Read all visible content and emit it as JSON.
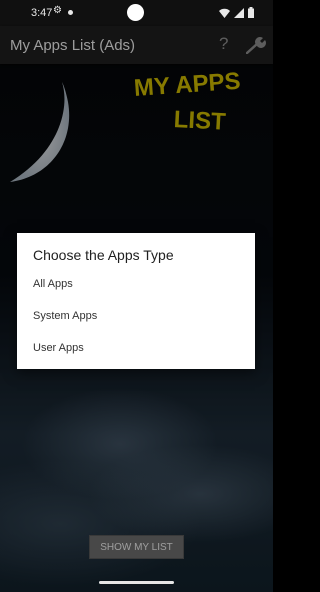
{
  "status_bar": {
    "time": "3:47"
  },
  "app_bar": {
    "title": "My Apps List (Ads)",
    "help_label": "?"
  },
  "logo": {
    "line1": "MY APPS",
    "line2": "LIST"
  },
  "dialog": {
    "title": "Choose the Apps Type",
    "options": [
      {
        "label": "All Apps"
      },
      {
        "label": "System Apps"
      },
      {
        "label": "User Apps"
      }
    ]
  },
  "main": {
    "show_button_label": "SHOW MY LIST"
  },
  "colors": {
    "logo_yellow": "#c8b400",
    "dialog_bg": "#ffffff",
    "button_bg": "#6a6a6a"
  }
}
